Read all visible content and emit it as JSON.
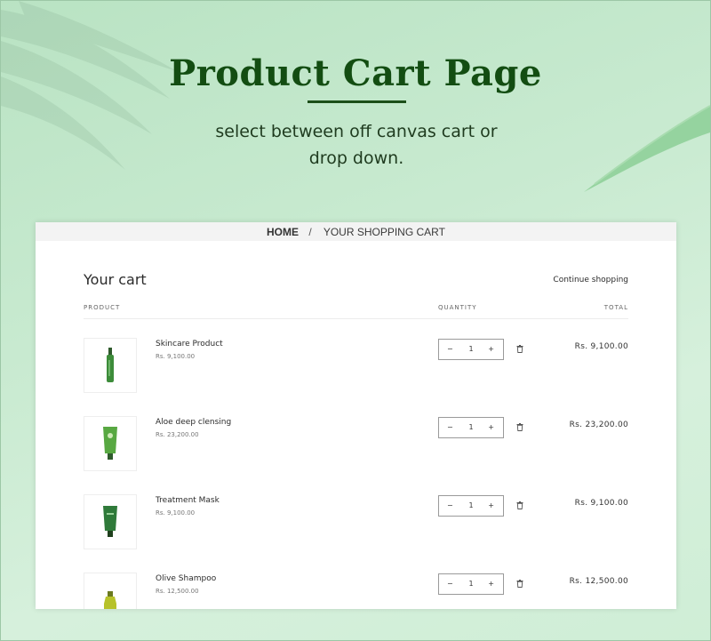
{
  "hero": {
    "title": "Product Cart Page",
    "subtitle_line1": "select between off canvas cart or",
    "subtitle_line2": "drop down."
  },
  "breadcrumb": {
    "home": "HOME",
    "separator": "/",
    "current": "YOUR SHOPPING CART"
  },
  "cart": {
    "title": "Your cart",
    "continue_label": "Continue shopping",
    "headers": {
      "product": "PRODUCT",
      "quantity": "QUANTITY",
      "total": "TOTAL"
    },
    "items": [
      {
        "name": "Skincare Product",
        "price": "Rs. 9,100.00",
        "quantity": "1",
        "total": "Rs. 9,100.00",
        "image": "green-serum-bottle"
      },
      {
        "name": "Aloe deep clensing",
        "price": "Rs. 23,200.00",
        "quantity": "1",
        "total": "Rs. 23,200.00",
        "image": "green-tube"
      },
      {
        "name": "Treatment Mask",
        "price": "Rs. 9,100.00",
        "quantity": "1",
        "total": "Rs. 9,100.00",
        "image": "dark-green-tube"
      },
      {
        "name": "Olive Shampoo",
        "price": "Rs. 12,500.00",
        "quantity": "1",
        "total": "Rs. 12,500.00",
        "image": "olive-bottle"
      }
    ]
  },
  "qty_controls": {
    "minus": "−",
    "plus": "+"
  },
  "icons": {
    "remove": "trash-icon"
  },
  "colors": {
    "title": "#134d12",
    "background": "#c8ead0",
    "panel": "#ffffff"
  }
}
